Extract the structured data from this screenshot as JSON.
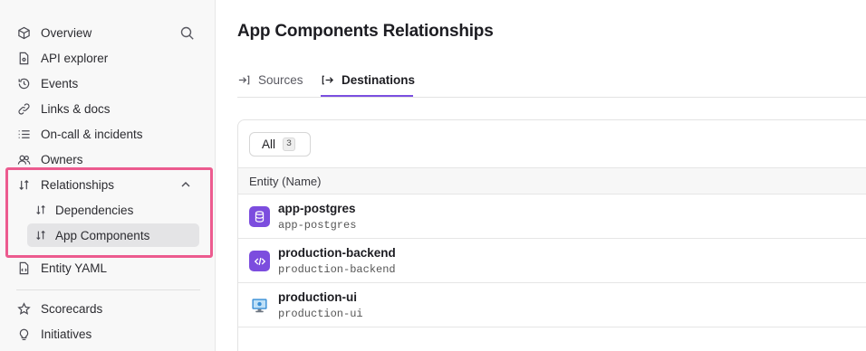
{
  "sidebar": {
    "items": [
      {
        "label": "Overview",
        "icon": "cube-icon"
      },
      {
        "label": "API explorer",
        "icon": "api-file-icon"
      },
      {
        "label": "Events",
        "icon": "history-icon"
      },
      {
        "label": "Links & docs",
        "icon": "link-icon"
      },
      {
        "label": "On-call & incidents",
        "icon": "list-icon"
      },
      {
        "label": "Owners",
        "icon": "users-icon"
      },
      {
        "label": "Relationships",
        "icon": "arrows-updown-icon"
      }
    ],
    "subitems": [
      {
        "label": "Dependencies",
        "icon": "arrows-updown-icon"
      },
      {
        "label": "App Components",
        "icon": "arrows-updown-icon",
        "active": true
      }
    ],
    "entity_yaml": "Entity YAML",
    "bottom_items": [
      {
        "label": "Scorecards",
        "icon": "star-icon"
      },
      {
        "label": "Initiatives",
        "icon": "lightbulb-icon"
      }
    ],
    "highlight_color": "#ec5b8f"
  },
  "main": {
    "title": "App Components Relationships",
    "tabs": [
      {
        "label": "Sources",
        "active": false
      },
      {
        "label": "Destinations",
        "active": true
      }
    ],
    "accent": "#7b4fe0",
    "filter": {
      "label": "All",
      "count": "3"
    },
    "table": {
      "header": "Entity (Name)",
      "rows": [
        {
          "name": "app-postgres",
          "tag": "app-postgres",
          "icon": "database-icon",
          "icon_color": "#7c4dde"
        },
        {
          "name": "production-backend",
          "tag": "production-backend",
          "icon": "code-icon",
          "icon_color": "#7c4dde"
        },
        {
          "name": "production-ui",
          "tag": "production-ui",
          "icon": "monitor-icon",
          "icon_color": "#3a8fd6"
        }
      ]
    }
  }
}
